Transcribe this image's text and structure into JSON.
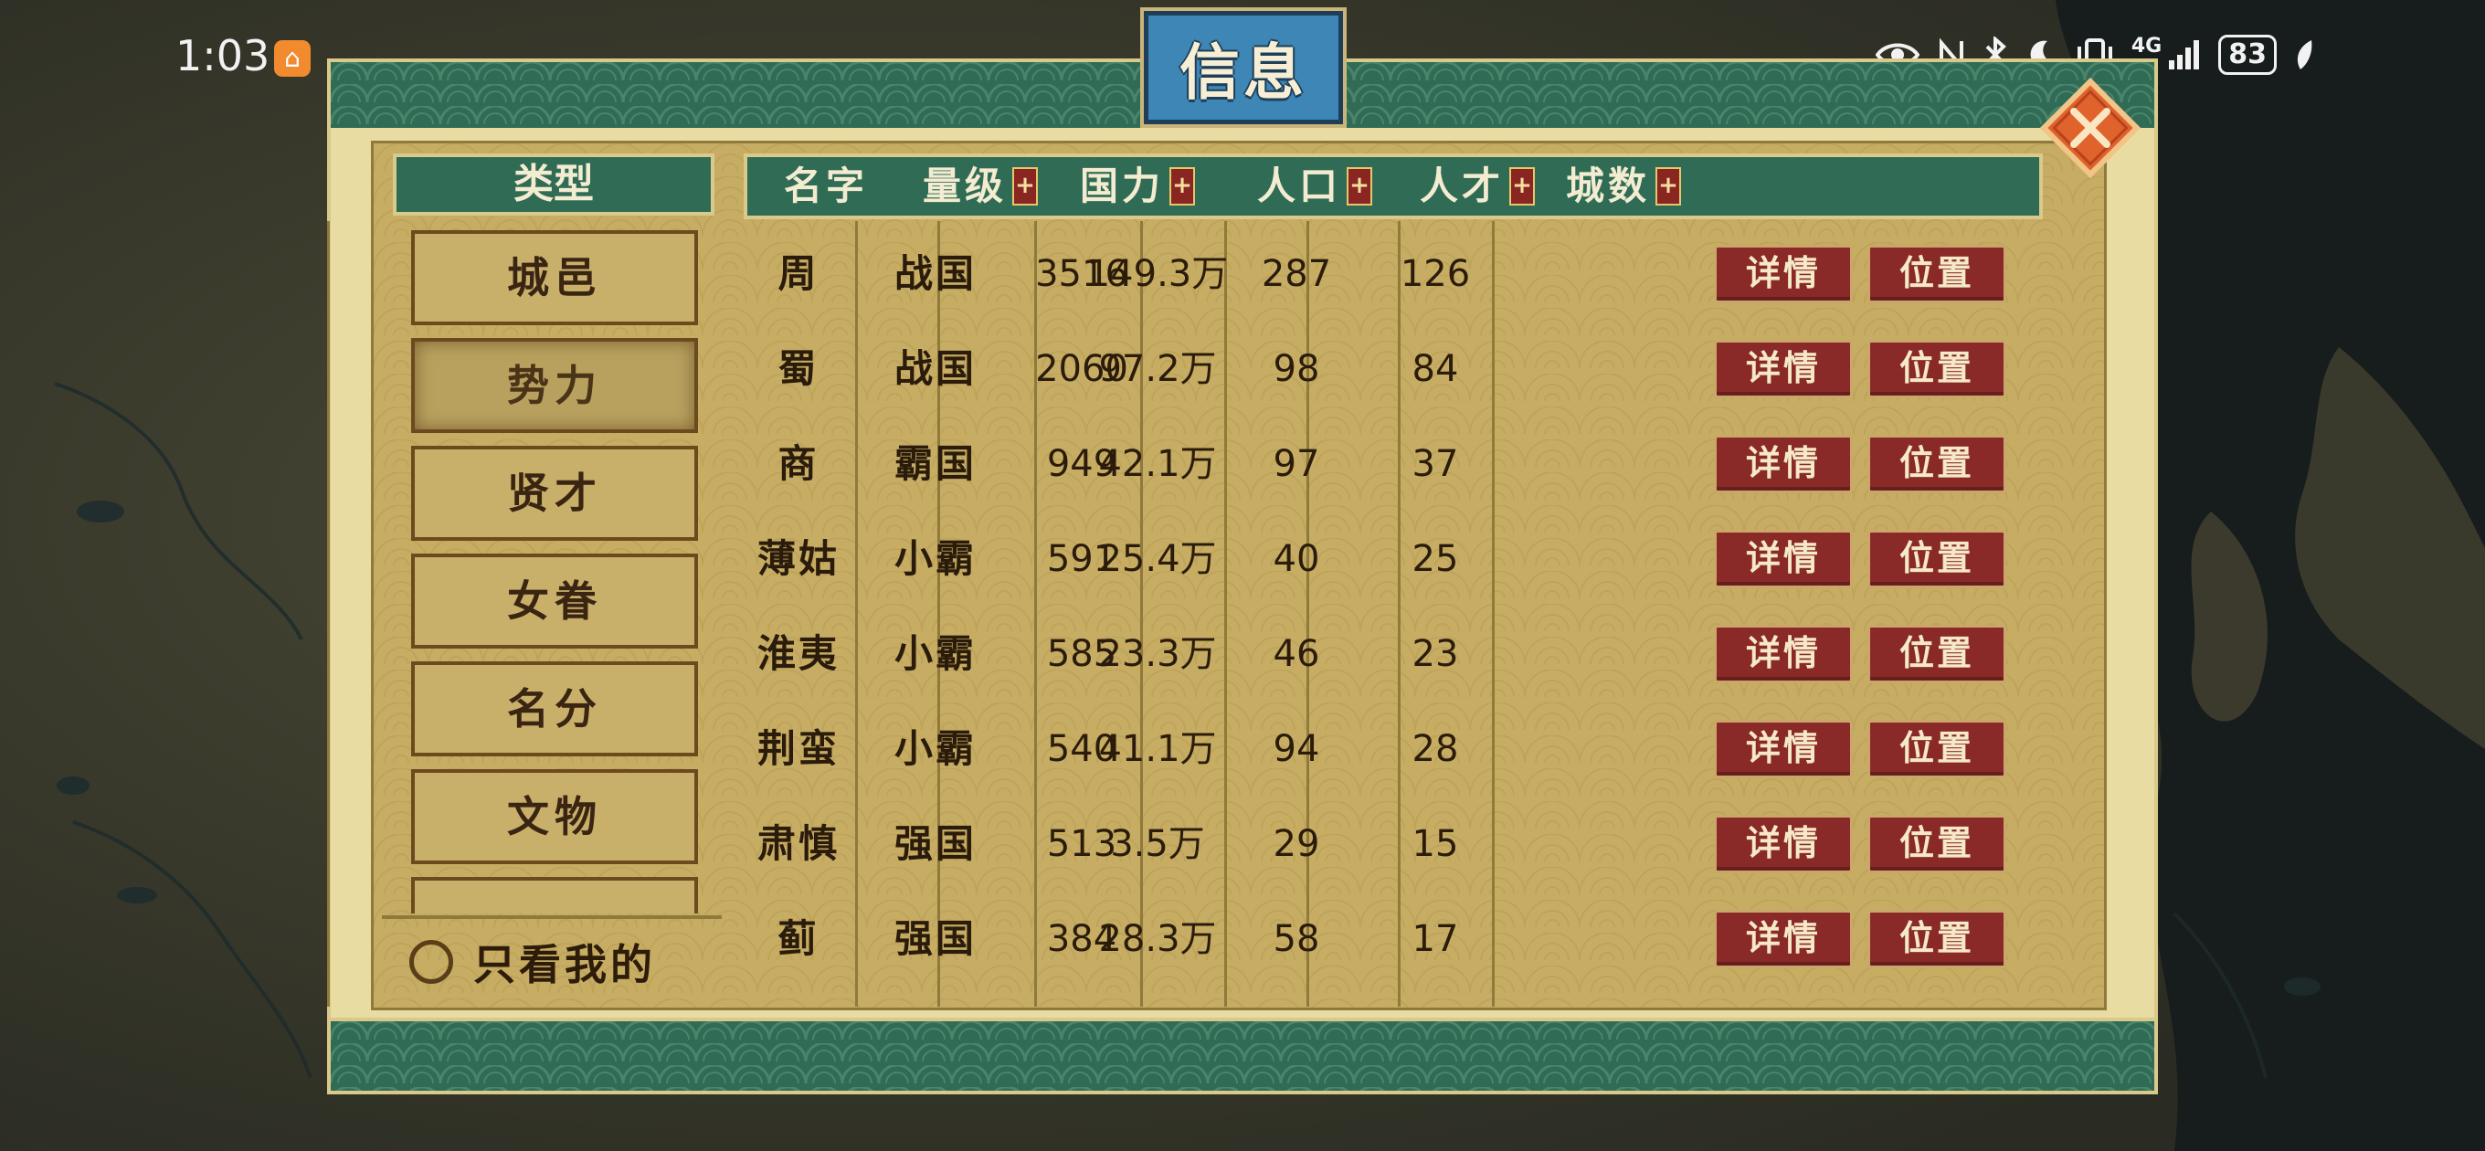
{
  "status_bar": {
    "time": "1:03",
    "app_icon": "home-app-icon",
    "network": "4G",
    "battery": "83",
    "icons": [
      "eye-icon",
      "nfc-icon",
      "bluetooth-icon",
      "moon-icon",
      "vibrate-icon",
      "signal-icon",
      "battery-icon",
      "leaf-icon"
    ]
  },
  "dialog": {
    "title": "信息",
    "close_icon": "close-x-icon"
  },
  "sidebar": {
    "header": "类型",
    "items": [
      {
        "label": "城邑",
        "active": false
      },
      {
        "label": "势力",
        "active": true
      },
      {
        "label": "贤才",
        "active": false
      },
      {
        "label": "女眷",
        "active": false
      },
      {
        "label": "名分",
        "active": false
      },
      {
        "label": "文物",
        "active": false
      }
    ],
    "only_mine": "只看我的"
  },
  "table": {
    "headers": [
      "名字",
      "量级",
      "国力",
      "人口",
      "人才",
      "城数"
    ],
    "sort_icon": "sort-toggle-icon",
    "detail_label": "详情",
    "locate_label": "位置",
    "rows": [
      {
        "name": "周",
        "rank": "战国",
        "power": "3516",
        "population": "149.3万",
        "talent": "287",
        "cities": "126"
      },
      {
        "name": "蜀",
        "rank": "战国",
        "power": "2060",
        "population": "97.2万",
        "talent": "98",
        "cities": "84"
      },
      {
        "name": "商",
        "rank": "霸国",
        "power": "949",
        "population": "42.1万",
        "talent": "97",
        "cities": "37"
      },
      {
        "name": "薄姑",
        "rank": "小霸",
        "power": "591",
        "population": "25.4万",
        "talent": "40",
        "cities": "25"
      },
      {
        "name": "淮夷",
        "rank": "小霸",
        "power": "585",
        "population": "23.3万",
        "talent": "46",
        "cities": "23"
      },
      {
        "name": "荆蛮",
        "rank": "小霸",
        "power": "540",
        "population": "41.1万",
        "talent": "94",
        "cities": "28"
      },
      {
        "name": "肃慎",
        "rank": "强国",
        "power": "513",
        "population": "3.5万",
        "talent": "29",
        "cities": "15"
      },
      {
        "name": "蓟",
        "rank": "强国",
        "power": "384",
        "population": "28.3万",
        "talent": "58",
        "cities": "17"
      }
    ]
  },
  "colors": {
    "frame_green": "#2f6b55",
    "parchment": "#c6ad63",
    "button_red": "#8a2a28",
    "title_blue": "#3d86b6",
    "close_orange": "#e0622c"
  }
}
